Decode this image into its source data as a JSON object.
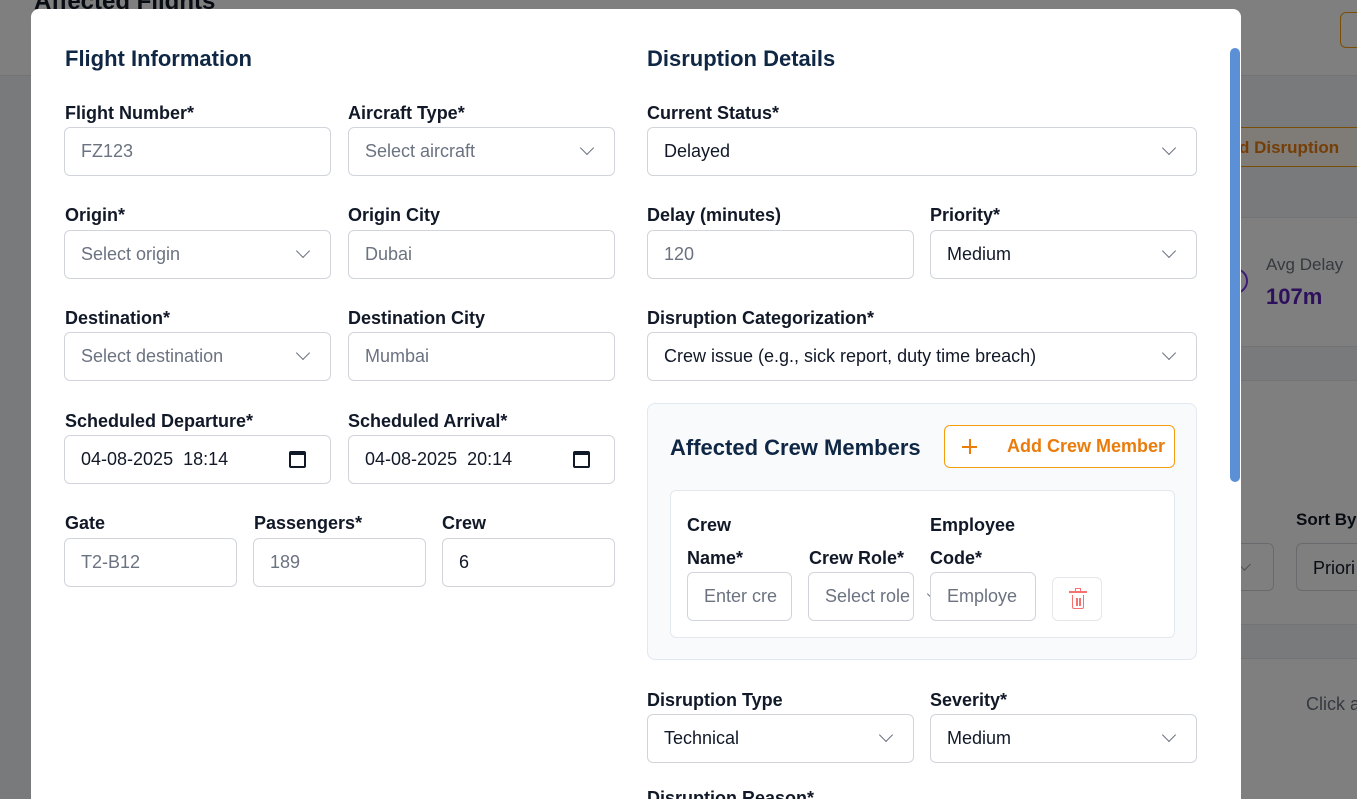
{
  "background": {
    "page_title": "Affected Flights",
    "add_disruption_label": "d Disruption",
    "stat_label": "Avg Delay",
    "stat_value": "107m",
    "sort_label": "Sort By",
    "sort_value": "Priori",
    "click_hint": "Click a"
  },
  "flight_info": {
    "title": "Flight Information",
    "flight_number": {
      "label": "Flight Number*",
      "value": "FZ123"
    },
    "aircraft_type": {
      "label": "Aircraft Type*",
      "placeholder": "Select aircraft"
    },
    "origin": {
      "label": "Origin*",
      "placeholder": "Select origin"
    },
    "origin_city": {
      "label": "Origin City",
      "value": "Dubai"
    },
    "destination": {
      "label": "Destination*",
      "placeholder": "Select destination"
    },
    "destination_city": {
      "label": "Destination City",
      "value": "Mumbai"
    },
    "scheduled_departure": {
      "label": "Scheduled Departure*",
      "value": "04-08-2025  18:14"
    },
    "scheduled_arrival": {
      "label": "Scheduled Arrival*",
      "value": "04-08-2025  20:14"
    },
    "gate": {
      "label": "Gate",
      "value": "T2-B12"
    },
    "passengers": {
      "label": "Passengers*",
      "value": "189"
    },
    "crew": {
      "label": "Crew",
      "value": "6"
    }
  },
  "disruption": {
    "title": "Disruption Details",
    "current_status": {
      "label": "Current Status*",
      "value": "Delayed"
    },
    "delay": {
      "label": "Delay (minutes)",
      "value": "120"
    },
    "priority": {
      "label": "Priority*",
      "value": "Medium"
    },
    "categorization": {
      "label": "Disruption Categorization*",
      "value": "Crew issue (e.g., sick report, duty time breach)"
    },
    "affected_crew": {
      "title": "Affected Crew Members",
      "add_button": "Add Crew Member",
      "name_label_line1": "Crew",
      "name_label_line2": "Name*",
      "name_placeholder": "Enter cre",
      "role_label": "Crew Role*",
      "role_placeholder": "Select role",
      "code_label_line1": "Employee",
      "code_label_line2": "Code*",
      "code_placeholder": "Employe"
    },
    "type": {
      "label": "Disruption Type",
      "value": "Technical"
    },
    "severity": {
      "label": "Severity*",
      "value": "Medium"
    },
    "reason_label": "Disruption Reason*"
  },
  "colors": {
    "accent": "#ea7c0c",
    "heading": "#0f2744",
    "scrollbar": "#5b8fd6",
    "danger": "#f87171"
  }
}
